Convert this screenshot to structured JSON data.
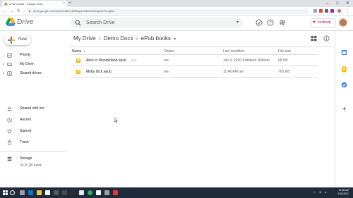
{
  "browser": {
    "tab_title": "ePub books - Google Drive",
    "new_tab": "+",
    "url": "drive.google.com/drive/folders/1fbB6pdnf2bcMsMhajdsbPehgf6w",
    "window_min": "–",
    "window_max": "□",
    "window_close": "✕"
  },
  "header": {
    "logo_text": "Drive",
    "search_placeholder": "Search Drive",
    "search_options": "▾",
    "brand_label": "texthelp",
    "brand_heart": "♥"
  },
  "sidebar": {
    "new_label": "New",
    "items": [
      {
        "label": "Priority",
        "icon": "check-icon",
        "caret": ""
      },
      {
        "label": "My Drive",
        "icon": "my-drive-icon",
        "caret": "▸"
      },
      {
        "label": "Shared drives",
        "icon": "shared-drives-icon",
        "caret": "▸"
      },
      {
        "label": "Shared with me",
        "icon": "people-icon",
        "caret": ""
      },
      {
        "label": "Recent",
        "icon": "clock-icon",
        "caret": ""
      },
      {
        "label": "Starred",
        "icon": "star-icon",
        "caret": ""
      },
      {
        "label": "Trash",
        "icon": "trash-icon",
        "caret": ""
      },
      {
        "label": "Storage",
        "icon": "storage-icon",
        "caret": ""
      }
    ],
    "storage_used": "24.8 GB used"
  },
  "breadcrumb": {
    "items": [
      "My Drive",
      "Demo Docs",
      "ePub books"
    ],
    "separator": "›",
    "dropdown": "▾"
  },
  "table": {
    "headers": {
      "name": "Name",
      "sort_arrow": "↑",
      "owner": "Owner",
      "modified": "Last modified",
      "size": "File size"
    },
    "rows": [
      {
        "name": "Alice in Wonderland.epub",
        "shared": "☺☺",
        "owner": "me",
        "modified": "Jan 9, 2020 Kathleen Dolbom",
        "size": "68 KB"
      },
      {
        "name": "Moby Dick.epub",
        "shared": "",
        "owner": "me",
        "modified": "11:46 AM me",
        "size": "765 KB"
      }
    ]
  },
  "taskbar": {
    "time": "11:48 AM",
    "date": "2/16/2021",
    "tray_arrow": "˄"
  },
  "colors": {
    "drive_blue": "#4285f4",
    "drive_green": "#0f9d58",
    "drive_yellow": "#f4b400",
    "drive_red": "#db4437",
    "epub_icon": "#f4b400",
    "taskbar": "#1f2a3a"
  }
}
